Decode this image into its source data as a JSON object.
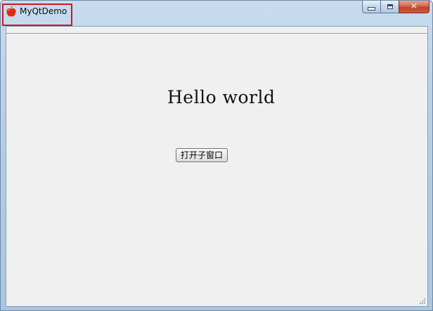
{
  "window": {
    "title": "MyQtDemo",
    "app_icon": "apple-icon",
    "caption_buttons": {
      "minimize_icon": "minimize-icon",
      "maximize_icon": "maximize-icon",
      "close_icon": "close-icon",
      "close_glyph": "✕"
    },
    "accent_color": "#d0181f"
  },
  "main": {
    "label_text": "Hello world",
    "open_child_button_label": "打开子窗口"
  }
}
